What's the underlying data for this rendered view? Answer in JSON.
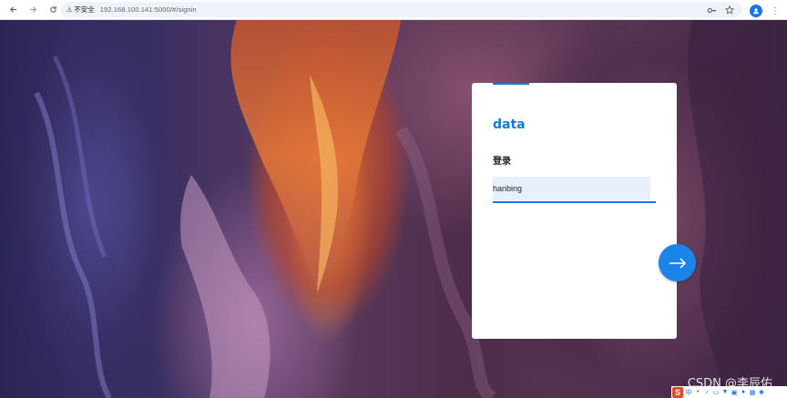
{
  "browser": {
    "security_label": "不安全",
    "url": "192.168.100.141:5000/#/signin"
  },
  "signin": {
    "brand": "data",
    "title": "登录",
    "username_value": "hanbing"
  },
  "watermark": "CSDN @李辰佑",
  "colors": {
    "accent": "#1a73e8",
    "brand": "#0f7ad8",
    "input_bg": "#e8f0fe",
    "next_button": "#1a84e8"
  },
  "icons": {
    "back": "arrow-left-icon",
    "forward": "arrow-right-icon",
    "reload": "reload-icon",
    "key": "key-icon",
    "bookmark": "star-icon",
    "profile": "profile-icon",
    "menu": "kebab-menu-icon",
    "next": "arrow-right-icon"
  }
}
